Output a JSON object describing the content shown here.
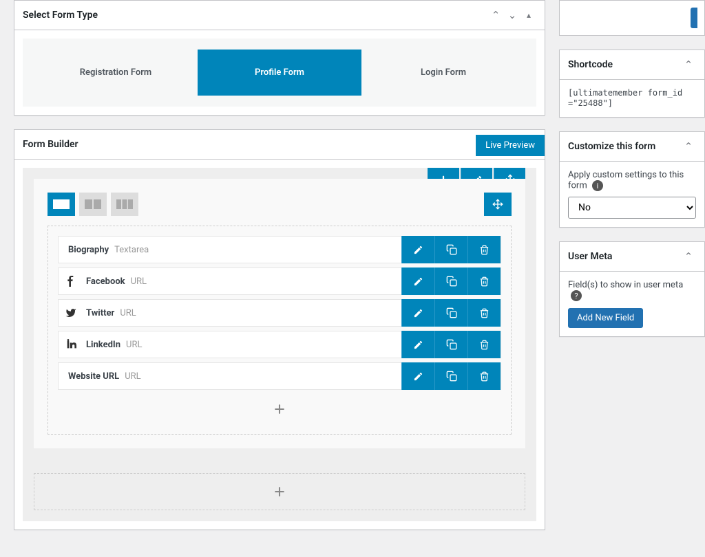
{
  "panels": {
    "select_form_type": {
      "title": "Select Form Type"
    },
    "form_builder": {
      "title": "Form Builder",
      "live_preview_label": "Live Preview"
    },
    "shortcode": {
      "title": "Shortcode",
      "code": "[ultimatemember form_id=\"25488\"]"
    },
    "customize": {
      "title": "Customize this form",
      "desc": "Apply custom settings to this form",
      "select_value": "No"
    },
    "user_meta": {
      "title": "User Meta",
      "desc": "Field(s) to show in user meta",
      "button_label": "Add New Field"
    }
  },
  "form_types": [
    {
      "label": "Registration Form",
      "active": false
    },
    {
      "label": "Profile Form",
      "active": true
    },
    {
      "label": "Login Form",
      "active": false
    }
  ],
  "fields": [
    {
      "icon": "",
      "name": "Biography",
      "type": "Textarea"
    },
    {
      "icon": "facebook",
      "name": "Facebook",
      "type": "URL"
    },
    {
      "icon": "twitter",
      "name": "Twitter",
      "type": "URL"
    },
    {
      "icon": "linkedin",
      "name": "LinkedIn",
      "type": "URL"
    },
    {
      "icon": "",
      "name": "Website URL",
      "type": "URL"
    }
  ],
  "colors": {
    "primary": "#0085ba",
    "wp_blue": "#2271b1"
  }
}
